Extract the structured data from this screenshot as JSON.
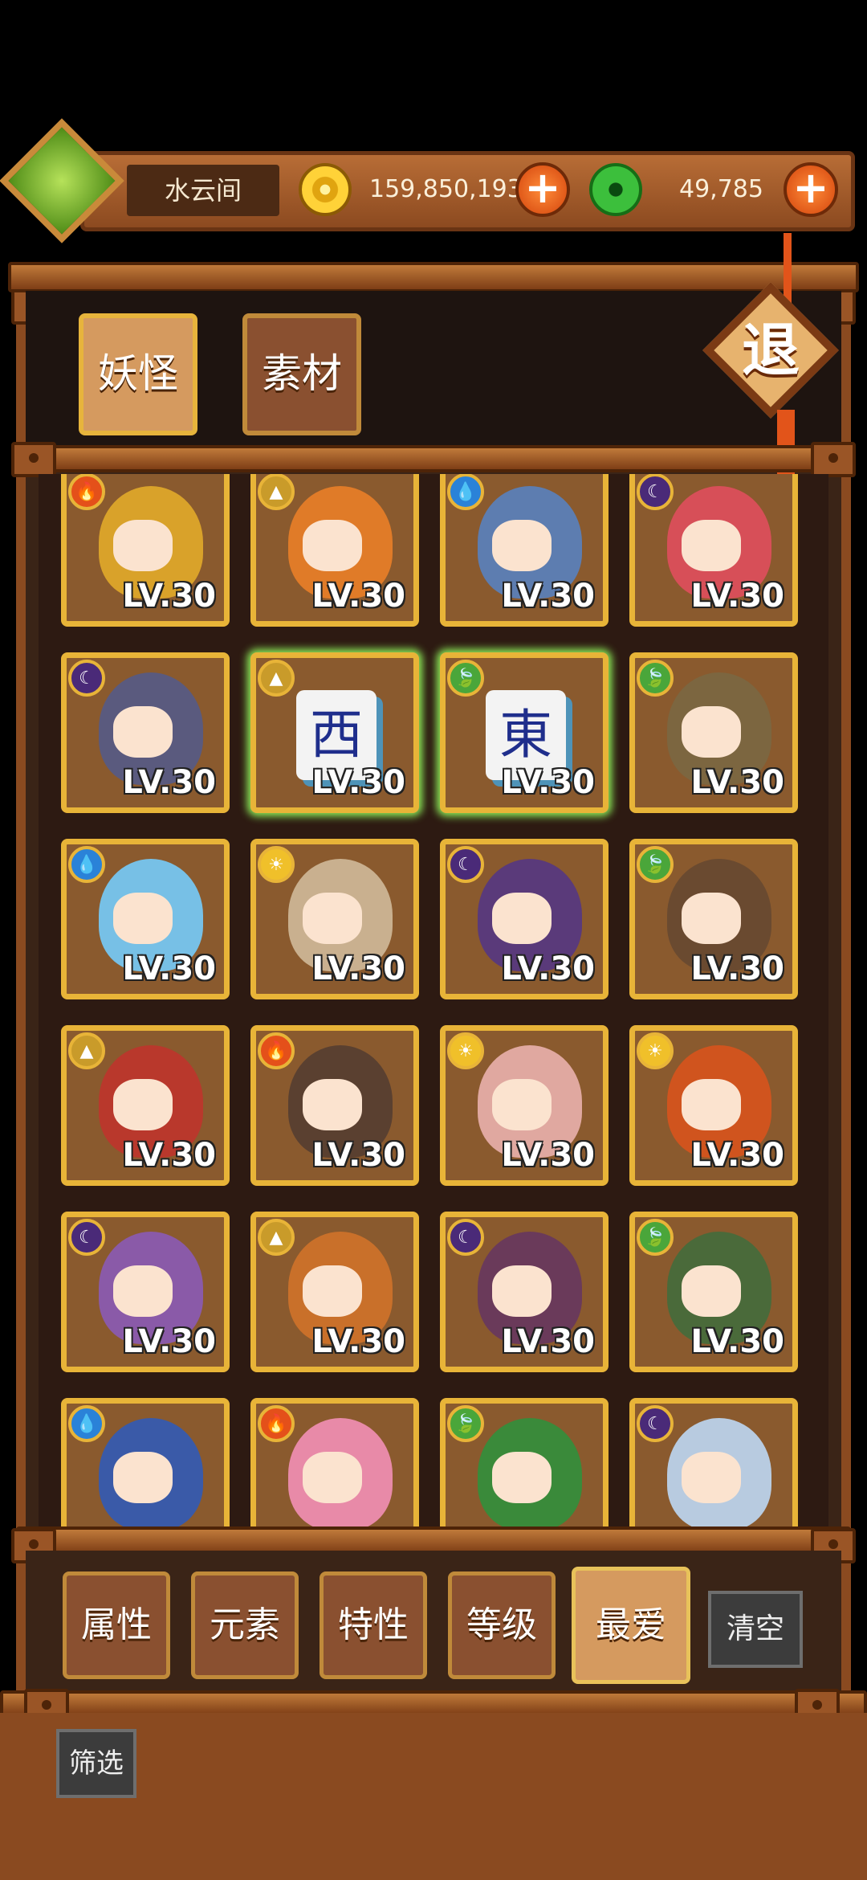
{
  "header": {
    "username": "水云间",
    "gold": "159,850,193",
    "jade": "49,785"
  },
  "tabs": [
    {
      "label": "妖怪",
      "active": true
    },
    {
      "label": "素材",
      "active": false
    }
  ],
  "exit_label": "退",
  "cards": [
    {
      "element": "fire",
      "level": "LV.30",
      "bg": "#d9a22a"
    },
    {
      "element": "earth",
      "level": "LV.30",
      "bg": "#e07b28"
    },
    {
      "element": "water",
      "level": "LV.30",
      "bg": "#5d7db0"
    },
    {
      "element": "dark",
      "level": "LV.30",
      "bg": "#d74f58"
    },
    {
      "element": "dark",
      "level": "LV.30",
      "bg": "#5a5a7e"
    },
    {
      "element": "earth",
      "level": "LV.30",
      "tile": "西"
    },
    {
      "element": "wood",
      "level": "LV.30",
      "tile": "東"
    },
    {
      "element": "wood",
      "level": "LV.30",
      "bg": "#7c6640"
    },
    {
      "element": "water",
      "level": "LV.30",
      "bg": "#77c0e6"
    },
    {
      "element": "light",
      "level": "LV.30",
      "bg": "#c9b08f"
    },
    {
      "element": "dark",
      "level": "LV.30",
      "bg": "#5a3a7a"
    },
    {
      "element": "wood",
      "level": "LV.30",
      "bg": "#6a4a30"
    },
    {
      "element": "earth",
      "level": "LV.30",
      "bg": "#b9382c"
    },
    {
      "element": "fire",
      "level": "LV.30",
      "bg": "#5a4030"
    },
    {
      "element": "light",
      "level": "LV.30",
      "bg": "#e0a8a0"
    },
    {
      "element": "light",
      "level": "LV.30",
      "bg": "#d0541e"
    },
    {
      "element": "dark",
      "level": "LV.30",
      "bg": "#8a5aa8"
    },
    {
      "element": "earth",
      "level": "LV.30",
      "bg": "#c9702a"
    },
    {
      "element": "dark",
      "level": "LV.30",
      "bg": "#6a3a5a"
    },
    {
      "element": "wood",
      "level": "LV.30",
      "bg": "#4a6a3a"
    },
    {
      "element": "water",
      "level": "",
      "bg": "#3a5aa8"
    },
    {
      "element": "fire",
      "level": "",
      "bg": "#e88aa8"
    },
    {
      "element": "wood",
      "level": "",
      "bg": "#3a8a3a"
    },
    {
      "element": "dark",
      "level": "",
      "bg": "#b8cbe0"
    }
  ],
  "filters": [
    "属性",
    "元素",
    "特性",
    "等级",
    "最爱"
  ],
  "clear_label": "清空",
  "filter_label": "筛选",
  "colors": {
    "fire": "#e4501a",
    "water": "#2a82d8",
    "wood": "#4aa63a",
    "earth": "#c99b2a",
    "light": "#f0c02a",
    "dark": "#4a2a78"
  }
}
